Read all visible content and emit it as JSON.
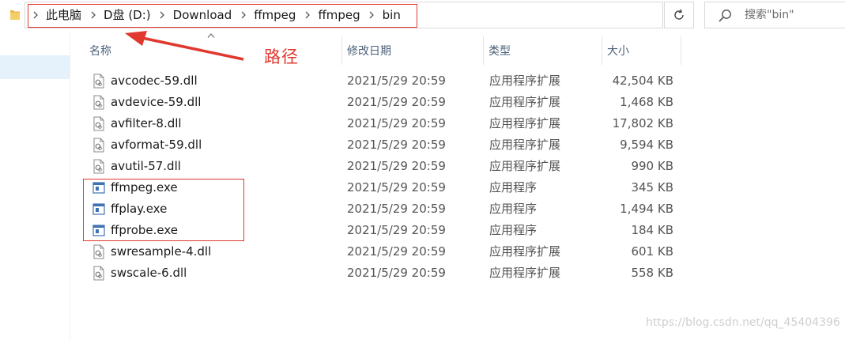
{
  "breadcrumbs": [
    "此电脑",
    "D盘 (D:)",
    "Download",
    "ffmpeg",
    "ffmpeg",
    "bin"
  ],
  "search": {
    "placeholder": "搜索\"bin\""
  },
  "columns": {
    "name": "名称",
    "date": "修改日期",
    "type": "类型",
    "size": "大小"
  },
  "files": [
    {
      "name": "avcodec-59.dll",
      "date": "2021/5/29 20:59",
      "type": "应用程序扩展",
      "size": "42,504 KB",
      "icon": "dll-file-icon"
    },
    {
      "name": "avdevice-59.dll",
      "date": "2021/5/29 20:59",
      "type": "应用程序扩展",
      "size": "1,468 KB",
      "icon": "dll-file-icon"
    },
    {
      "name": "avfilter-8.dll",
      "date": "2021/5/29 20:59",
      "type": "应用程序扩展",
      "size": "17,802 KB",
      "icon": "dll-file-icon"
    },
    {
      "name": "avformat-59.dll",
      "date": "2021/5/29 20:59",
      "type": "应用程序扩展",
      "size": "9,594 KB",
      "icon": "dll-file-icon"
    },
    {
      "name": "avutil-57.dll",
      "date": "2021/5/29 20:59",
      "type": "应用程序扩展",
      "size": "990 KB",
      "icon": "dll-file-icon"
    },
    {
      "name": "ffmpeg.exe",
      "date": "2021/5/29 20:59",
      "type": "应用程序",
      "size": "345 KB",
      "icon": "exe-file-icon"
    },
    {
      "name": "ffplay.exe",
      "date": "2021/5/29 20:59",
      "type": "应用程序",
      "size": "1,494 KB",
      "icon": "exe-file-icon"
    },
    {
      "name": "ffprobe.exe",
      "date": "2021/5/29 20:59",
      "type": "应用程序",
      "size": "184 KB",
      "icon": "exe-file-icon"
    },
    {
      "name": "swresample-4.dll",
      "date": "2021/5/29 20:59",
      "type": "应用程序扩展",
      "size": "601 KB",
      "icon": "dll-file-icon"
    },
    {
      "name": "swscale-6.dll",
      "date": "2021/5/29 20:59",
      "type": "应用程序扩展",
      "size": "558 KB",
      "icon": "dll-file-icon"
    }
  ],
  "annotation": {
    "label": "路径",
    "color": "#e0382f"
  },
  "watermark": "https://blog.csdn.net/qq_45404396"
}
